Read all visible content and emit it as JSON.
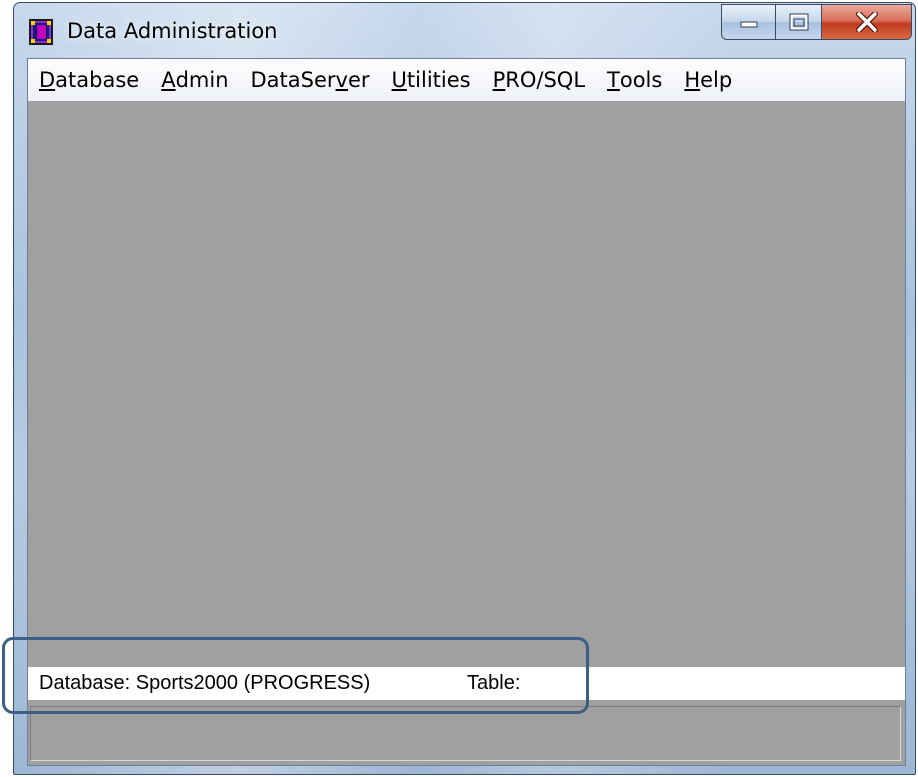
{
  "window": {
    "title": "Data Administration",
    "icon": "data-admin-app-icon",
    "controls": {
      "minimize": "minimize-icon",
      "maximize": "maximize-icon",
      "close": "close-icon"
    }
  },
  "menu": {
    "items": [
      {
        "mnemonic": "D",
        "rest": "atabase"
      },
      {
        "mnemonic": "A",
        "rest": "dmin"
      },
      {
        "pre": "DataSer",
        "mnemonic": "v",
        "rest": "er"
      },
      {
        "mnemonic": "U",
        "rest": "tilities"
      },
      {
        "mnemonic": "P",
        "rest": "RO/SQL"
      },
      {
        "mnemonic": "T",
        "rest": "ools"
      },
      {
        "mnemonic": "H",
        "rest": "elp"
      }
    ]
  },
  "status": {
    "database": "Database: Sports2000 (PROGRESS)",
    "table": "Table:"
  },
  "colors": {
    "workspace": "#a0a0a0",
    "highlight": "#3d5f86",
    "close_button": "#c23b1f"
  }
}
